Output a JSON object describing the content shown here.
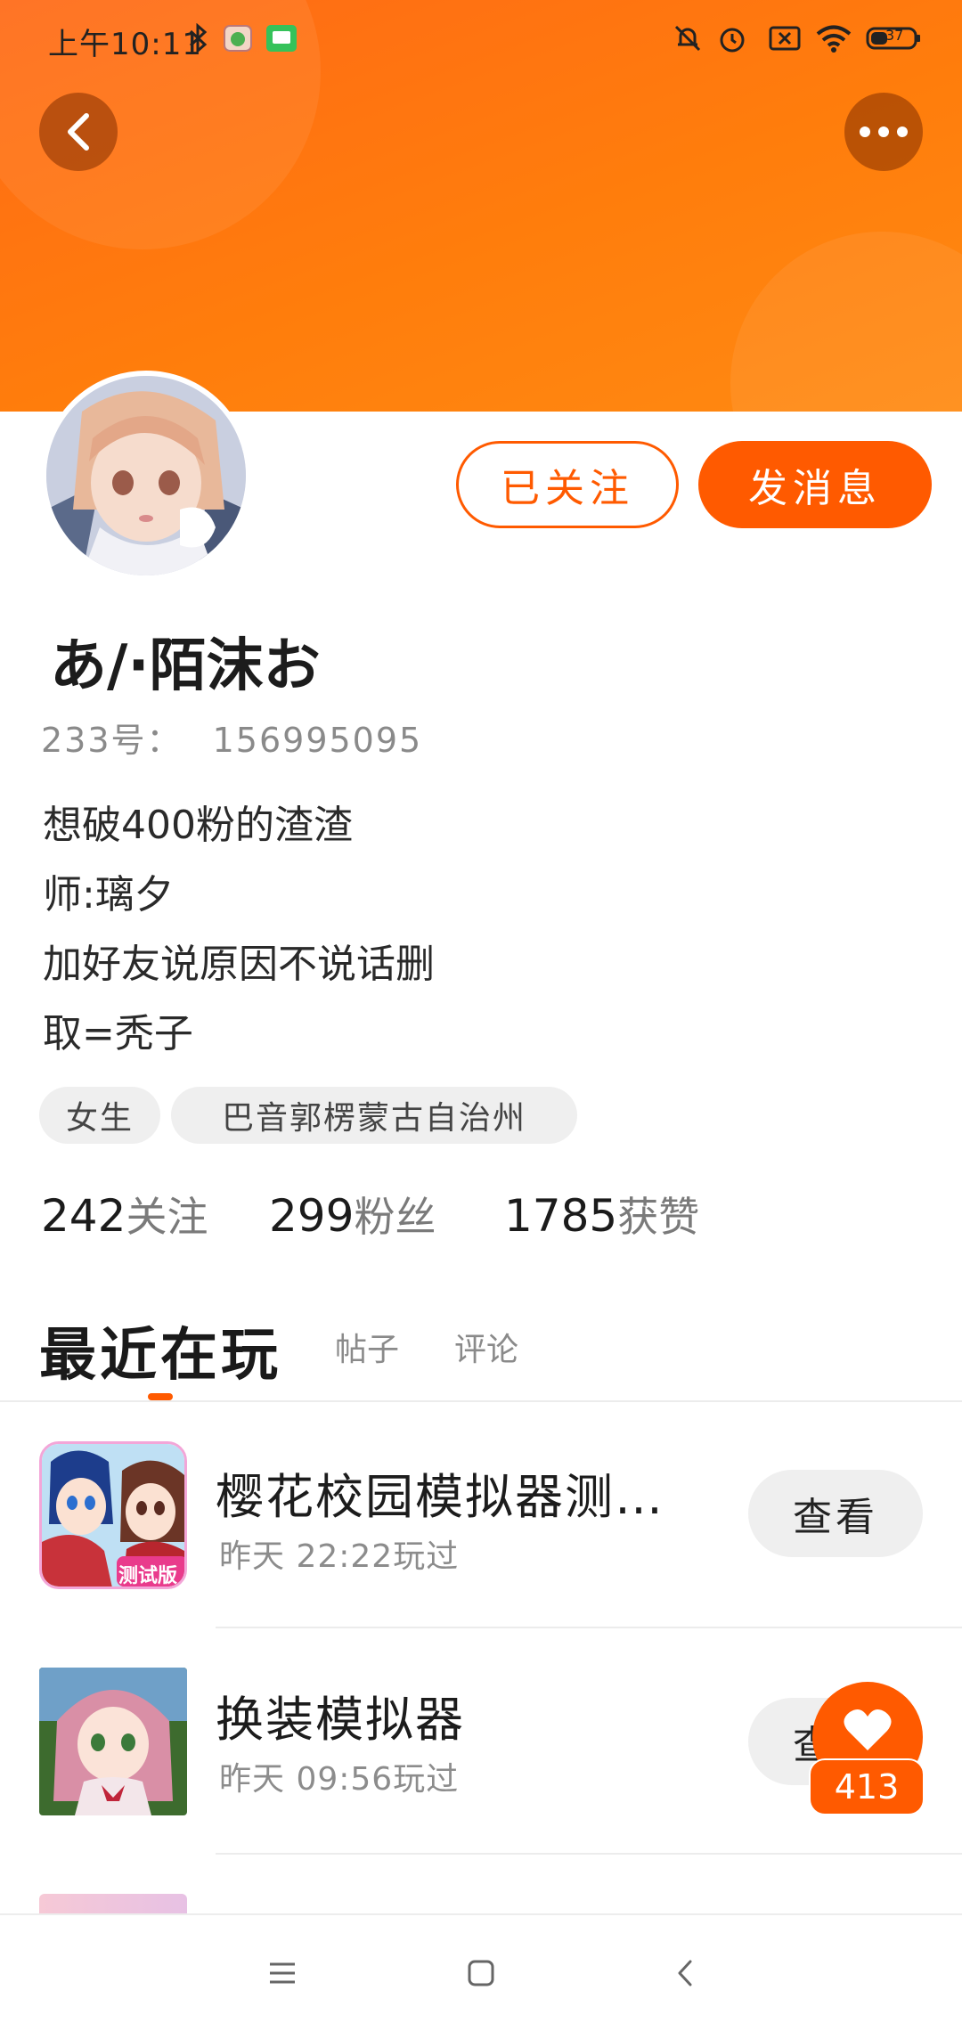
{
  "status_bar": {
    "time": "上午10:11",
    "battery": "37",
    "icons": [
      "bluetooth-icon",
      "app-notification-icon",
      "message-notification-icon",
      "mute-icon",
      "alarm-icon",
      "sim-off-icon",
      "wifi-icon",
      "battery-icon"
    ]
  },
  "header": {
    "back_icon": "chevron-left-icon",
    "more_icon": "more-dots-icon",
    "gradient_start": "#ff6a16",
    "gradient_end": "#ff8a12"
  },
  "profile": {
    "username": "あ/·陌沫お",
    "id_label": "233号：",
    "id_value": "156995095",
    "bio": [
      "想破400粉的渣渣",
      "师:璃夕",
      "加好友说原因不说话删",
      "取=秃子"
    ],
    "tags": [
      "女生",
      "巴音郭楞蒙古自治州"
    ],
    "follow_button": "已关注",
    "message_button": "发消息",
    "stats": [
      {
        "num": "242",
        "label": "关注"
      },
      {
        "num": "299",
        "label": "粉丝"
      },
      {
        "num": "1785",
        "label": "获赞"
      }
    ]
  },
  "tabs": {
    "active": "最近在玩",
    "others": [
      "帖子",
      "评论"
    ]
  },
  "games": [
    {
      "name": "樱花校园模拟器测试版",
      "time": "昨天 22:22玩过",
      "button": "查看",
      "badge": "测试版"
    },
    {
      "name": "换装模拟器",
      "time": "昨天 09:56玩过",
      "button": "查看"
    }
  ],
  "like_float": {
    "count": "413",
    "icon": "heart-icon"
  },
  "nav_bar": {
    "icons": [
      "menu-icon",
      "home-square-icon",
      "back-triangle-icon"
    ]
  },
  "colors": {
    "accent": "#ff5a00",
    "chip_bg": "#efefef",
    "text_secondary": "#8a8a8a"
  }
}
